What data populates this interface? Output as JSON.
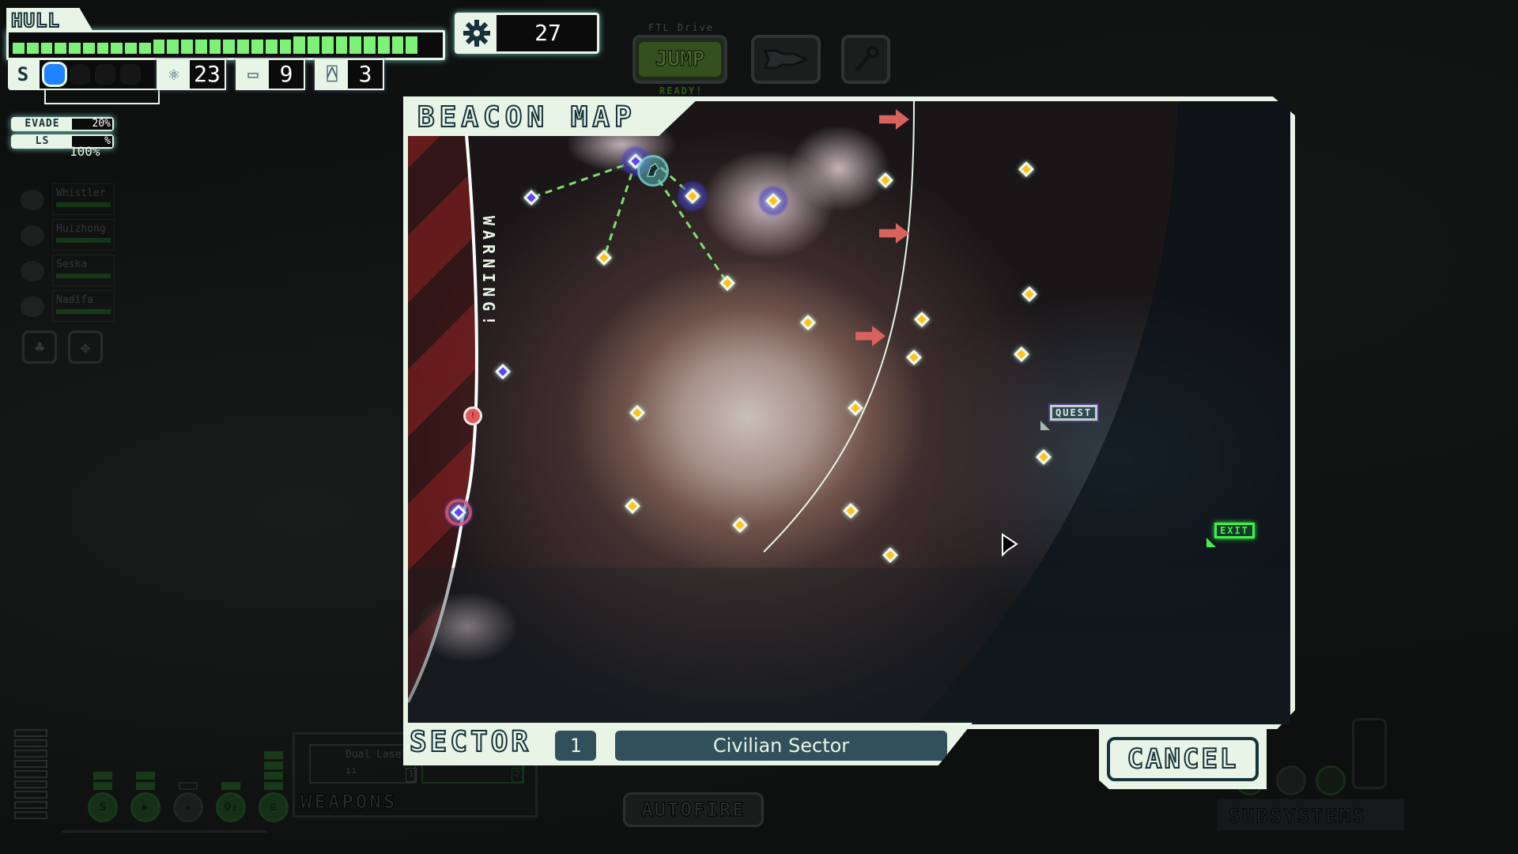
{
  "hud": {
    "hull": {
      "label": "HULL",
      "segments_total": 30,
      "segments_filled": 29
    },
    "scrap": {
      "icon": "gear-icon",
      "value": "27"
    },
    "shields": {
      "icon": "shield-icon",
      "icon_glyph": "S",
      "pips_total": 4,
      "pips_on": 1
    },
    "fuel": {
      "icon": "fuel-atom-icon",
      "value": "23"
    },
    "missiles": {
      "icon": "missile-icon",
      "value": "9"
    },
    "drones": {
      "icon": "drone-icon",
      "value": "3"
    },
    "evade": {
      "label": "EVADE",
      "value": "20%"
    },
    "life_support": {
      "label": "LS",
      "value": "%",
      "oxygen": "100%"
    },
    "crew": [
      {
        "name": "Whistler",
        "health": 1.0
      },
      {
        "name": "Huizhong",
        "health": 1.0
      },
      {
        "name": "Seska",
        "health": 1.0
      },
      {
        "name": "Nadifa",
        "health": 1.0
      }
    ],
    "ftl": {
      "label": "FTL Drive",
      "jump": "JUMP",
      "status": "READY!"
    },
    "weapons": {
      "label": "WEAPONS",
      "weapon_1": "Dual Laser",
      "weapon_1_slot": "1",
      "weapon_2_slot": "2",
      "autofire": "AUTOFIRE"
    },
    "subsystems": {
      "label": "SUBSYSTEMS"
    }
  },
  "beacon_map": {
    "title": "BEACON MAP",
    "warning": "WARNING!",
    "sector_label": "SECTOR",
    "sector_number": "1",
    "sector_name": "Civilian Sector",
    "cancel": "CANCEL",
    "quest_label": "QUEST",
    "exit_label": "EXIT",
    "colors": {
      "beacon": "#ffc21a",
      "visited": "#6046ff",
      "fleet": "#d8625e",
      "exit": "#3ef24a",
      "frame": "#e8f4e6"
    }
  }
}
